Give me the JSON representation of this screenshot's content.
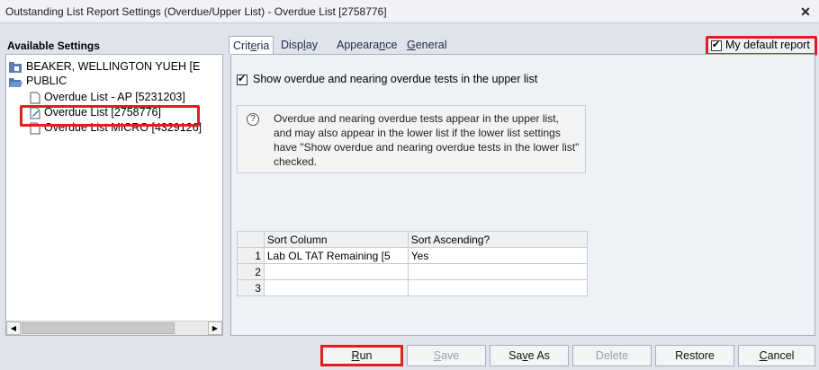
{
  "window": {
    "title": "Outstanding List Report Settings (Overdue/Upper List) - Overdue List [2758776]",
    "close_label": "✕"
  },
  "left": {
    "header": "Available Settings",
    "tree": [
      {
        "label": "BEAKER, WELLINGTON YUEH [E",
        "icon": "user-folder-icon"
      },
      {
        "label": "PUBLIC",
        "icon": "folder-open-icon"
      },
      {
        "label": "Overdue List - AP [5231203]",
        "icon": "document-icon"
      },
      {
        "label": "Overdue List [2758776]",
        "icon": "edit-document-icon",
        "selected": true
      },
      {
        "label": "Overdue List MICRO [4329126]",
        "icon": "document-icon"
      }
    ]
  },
  "tabs": [
    {
      "pre": "Crit",
      "u": "e",
      "post": "ria",
      "active": true
    },
    {
      "pre": "Disp",
      "u": "l",
      "post": "ay",
      "active": false
    },
    {
      "pre": "Appeara",
      "u": "n",
      "post": "ce",
      "active": false
    },
    {
      "pre": "",
      "u": "G",
      "post": "eneral",
      "active": false
    }
  ],
  "default_report": {
    "label": "My default report",
    "checked": true
  },
  "criteria": {
    "show_overdue_label": "Show overdue and nearing overdue tests in the upper list",
    "show_overdue_checked": true,
    "info_icon": "?",
    "info_text": "Overdue and nearing overdue tests appear in the upper list, and may also appear in the lower list if the lower list settings have \"Show overdue and nearing overdue tests in the lower list\" checked.",
    "grid": {
      "headers": [
        "",
        "Sort Column",
        "Sort Ascending?"
      ],
      "rows": [
        {
          "num": "1",
          "column": "Lab OL TAT Remaining [5",
          "ascending": "Yes"
        },
        {
          "num": "2",
          "column": "",
          "ascending": ""
        },
        {
          "num": "3",
          "column": "",
          "ascending": ""
        }
      ]
    }
  },
  "buttons": {
    "run": {
      "pre": "",
      "u": "R",
      "post": "un"
    },
    "save": {
      "pre": "",
      "u": "S",
      "post": "ave"
    },
    "save_as": {
      "pre": "Sa",
      "u": "v",
      "post": "e As"
    },
    "delete": {
      "pre": "Delete",
      "u": "",
      "post": ""
    },
    "restore": {
      "pre": "Restore",
      "u": "",
      "post": ""
    },
    "cancel": {
      "pre": "",
      "u": "C",
      "post": "ancel"
    }
  },
  "colors": {
    "highlight": "#e0201f",
    "panel": "#eef1f6",
    "window": "#dfe4ec"
  }
}
